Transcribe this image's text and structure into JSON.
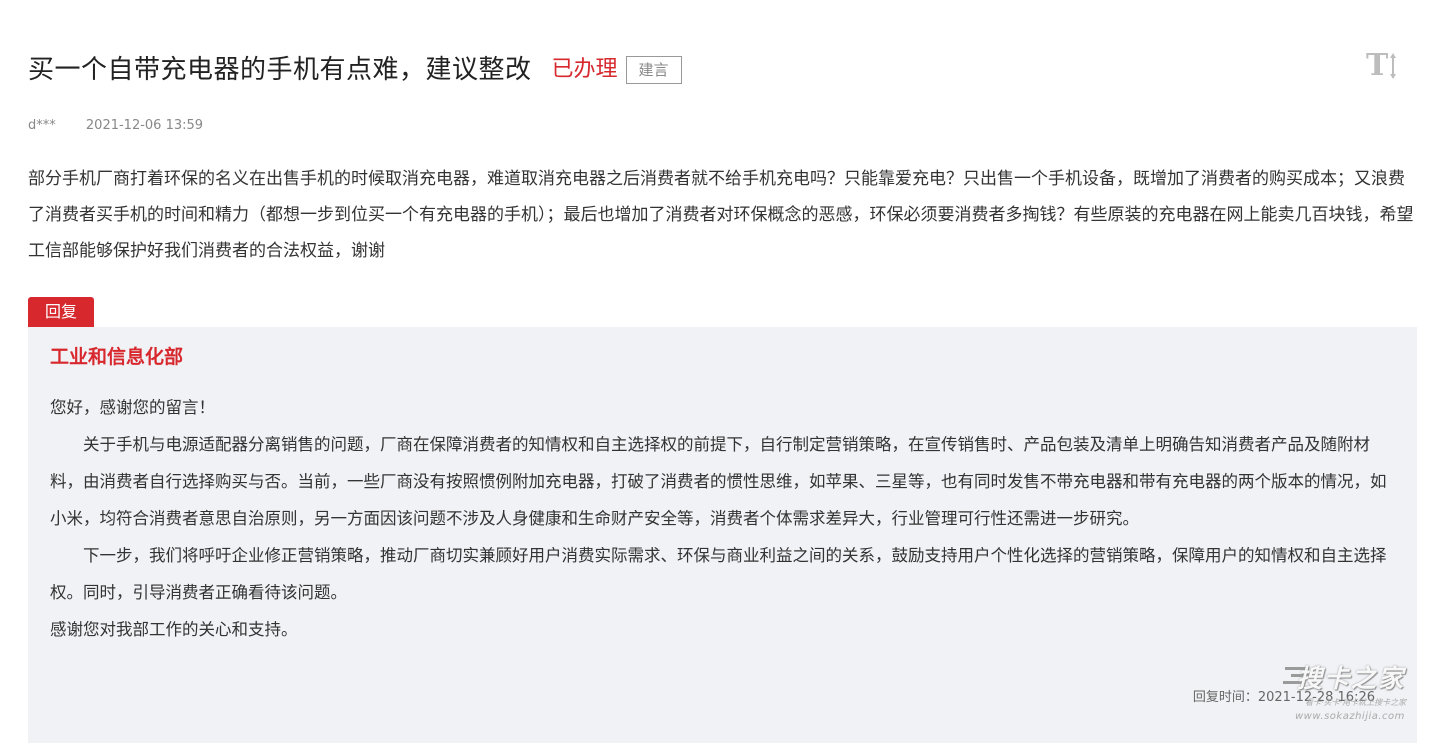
{
  "header": {
    "title": "买一个自带充电器的手机有点难，建议整改",
    "status": "已办理",
    "tag": "建言",
    "font_toggle_label": "T"
  },
  "meta": {
    "author": "d***",
    "datetime": "2021-12-06 13:59"
  },
  "message": {
    "content": "部分手机厂商打着环保的名义在出售手机的时候取消充电器，难道取消充电器之后消费者就不给手机充电吗？只能靠爱充电？只出售一个手机设备，既增加了消费者的购买成本；又浪费了消费者买手机的时间和精力（都想一步到位买一个有充电器的手机）；最后也增加了消费者对环保概念的恶感，环保必须要消费者多掏钱？有些原装的充电器在网上能卖几百块钱，希望工信部能够保护好我们消费者的合法权益，谢谢"
  },
  "reply": {
    "label": "回复",
    "department": "工业和信息化部",
    "greeting": "您好，感谢您的留言！",
    "paragraph1": "关于手机与电源适配器分离销售的问题，厂商在保障消费者的知情权和自主选择权的前提下，自行制定营销策略，在宣传销售时、产品包装及清单上明确告知消费者产品及随附材料，由消费者自行选择购买与否。当前，一些厂商没有按照惯例附加充电器，打破了消费者的惯性思维，如苹果、三星等，也有同时发售不带充电器和带有充电器的两个版本的情况，如小米，均符合消费者意思自治原则，另一方面因该问题不涉及人身健康和生命财产安全等，消费者个体需求差异大，行业管理可行性还需进一步研究。",
    "paragraph2": "下一步，我们将呼吁企业修正营销策略，推动厂商切实兼顾好用户消费实际需求、环保与商业利益之间的关系，鼓励支持用户个性化选择的营销策略，保障用户的知情权和自主选择权。同时，引导消费者正确看待该问题。",
    "closing": "感谢您对我部工作的关心和支持。",
    "time": "回复时间：2021-12-28 16:26"
  },
  "watermark": {
    "logo_text": "搜卡之家",
    "slogan": "看卡·买卡·用卡就上搜卡之家",
    "url": "www.sokazhijia.com"
  },
  "colors": {
    "accent": "#d7282e",
    "reply_bg": "#f1f2f6",
    "text": "#333333",
    "muted": "#888888"
  }
}
